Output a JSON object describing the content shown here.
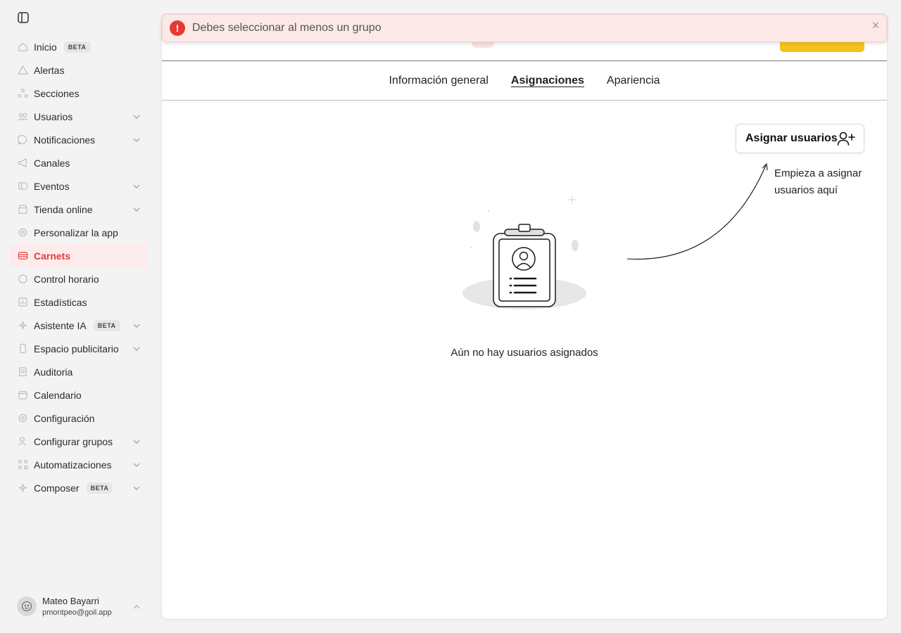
{
  "toast": {
    "message": "Debes seleccionar al menos un grupo",
    "icon": "alert-circle-icon",
    "close_icon": "close-icon",
    "color": "#e53935"
  },
  "sidebar": {
    "items": [
      {
        "label": "Inicio",
        "icon": "home-icon",
        "badge": "BETA",
        "chevron": false
      },
      {
        "label": "Alertas",
        "icon": "alert-triangle-icon",
        "badge": "",
        "chevron": false
      },
      {
        "label": "Secciones",
        "icon": "sections-icon",
        "badge": "",
        "chevron": false
      },
      {
        "label": "Usuarios",
        "icon": "users-icon",
        "badge": "",
        "chevron": true
      },
      {
        "label": "Notificaciones",
        "icon": "chat-icon",
        "badge": "",
        "chevron": true
      },
      {
        "label": "Canales",
        "icon": "megaphone-icon",
        "badge": "",
        "chevron": false
      },
      {
        "label": "Eventos",
        "icon": "ticket-icon",
        "badge": "",
        "chevron": true
      },
      {
        "label": "Tienda online",
        "icon": "store-icon",
        "badge": "",
        "chevron": true
      },
      {
        "label": "Personalizar la app",
        "icon": "gear-icon",
        "badge": "",
        "chevron": false
      },
      {
        "label": "Carnets",
        "icon": "card-icon",
        "badge": "",
        "chevron": false,
        "active": true
      },
      {
        "label": "Control horario",
        "icon": "clock-icon",
        "badge": "",
        "chevron": false
      },
      {
        "label": "Estadísticas",
        "icon": "chart-icon",
        "badge": "",
        "chevron": false
      },
      {
        "label": "Asistente IA",
        "icon": "sparkle-icon",
        "badge": "BETA",
        "chevron": true
      },
      {
        "label": "Espacio publicitario",
        "icon": "phone-icon",
        "badge": "",
        "chevron": true
      },
      {
        "label": "Auditoria",
        "icon": "document-icon",
        "badge": "",
        "chevron": false
      },
      {
        "label": "Calendario",
        "icon": "calendar-icon",
        "badge": "",
        "chevron": false
      },
      {
        "label": "Configuración",
        "icon": "settings-icon",
        "badge": "",
        "chevron": false
      },
      {
        "label": "Configurar grupos",
        "icon": "user-group-icon",
        "badge": "",
        "chevron": true
      },
      {
        "label": "Automatizaciones",
        "icon": "flow-icon",
        "badge": "",
        "chevron": true
      },
      {
        "label": "Composer",
        "icon": "sparkle-icon",
        "badge": "BETA",
        "chevron": true
      }
    ],
    "user": {
      "name": "Mateo Bayarri",
      "email": "pmontpeo@goil.app"
    },
    "active_color": "#e23d3d"
  },
  "main": {
    "tabs": [
      {
        "label": "Información general",
        "active": false
      },
      {
        "label": "Asignaciones",
        "active": true
      },
      {
        "label": "Apariencia",
        "active": false
      }
    ],
    "assign_button": "Asignar usuarios",
    "hint": "Empieza a asignar usuarios aquí",
    "empty_text": "Aún no hay usuarios asignados"
  }
}
